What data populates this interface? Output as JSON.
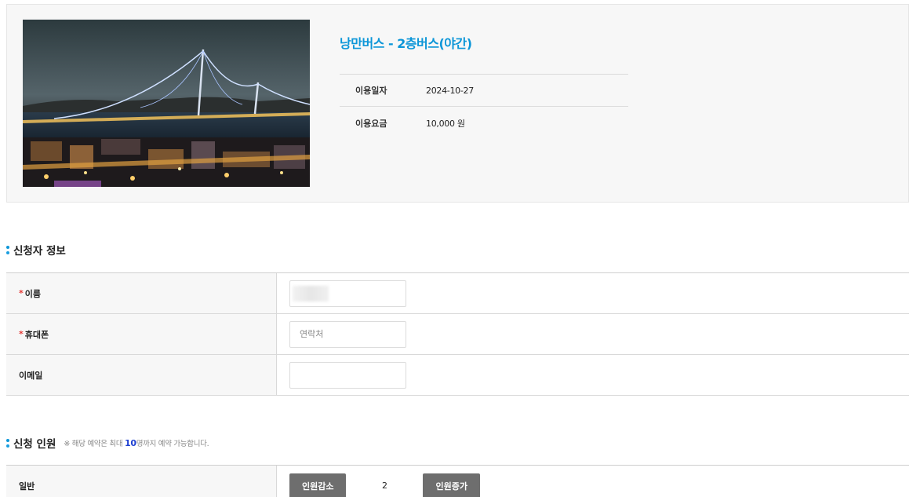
{
  "product": {
    "title": "낭만버스 - 2층버스(야간)",
    "image_alt": "night bridge view",
    "info": [
      {
        "label": "이용일자",
        "value": "2024-10-27"
      },
      {
        "label": "이용요금",
        "value": "10,000 원"
      }
    ]
  },
  "applicant": {
    "section_title": "신청자 정보",
    "fields": {
      "name": {
        "label": "이름",
        "required": "*"
      },
      "phone": {
        "label": "휴대폰",
        "required": "*",
        "placeholder": "연락처"
      },
      "email": {
        "label": "이메일"
      }
    }
  },
  "headcount": {
    "section_title": "신청 인원",
    "note_prefix": "※ 해당 예약은 최대 ",
    "note_max": "10",
    "note_suffix": "명까지 예약 가능합니다.",
    "rows": [
      {
        "label": "일반",
        "decrease_label": "인원감소",
        "value": "2",
        "increase_label": "인원증가"
      }
    ]
  },
  "colors": {
    "accent": "#0c96d8",
    "required": "#e53935",
    "button": "#6e6e6e"
  }
}
